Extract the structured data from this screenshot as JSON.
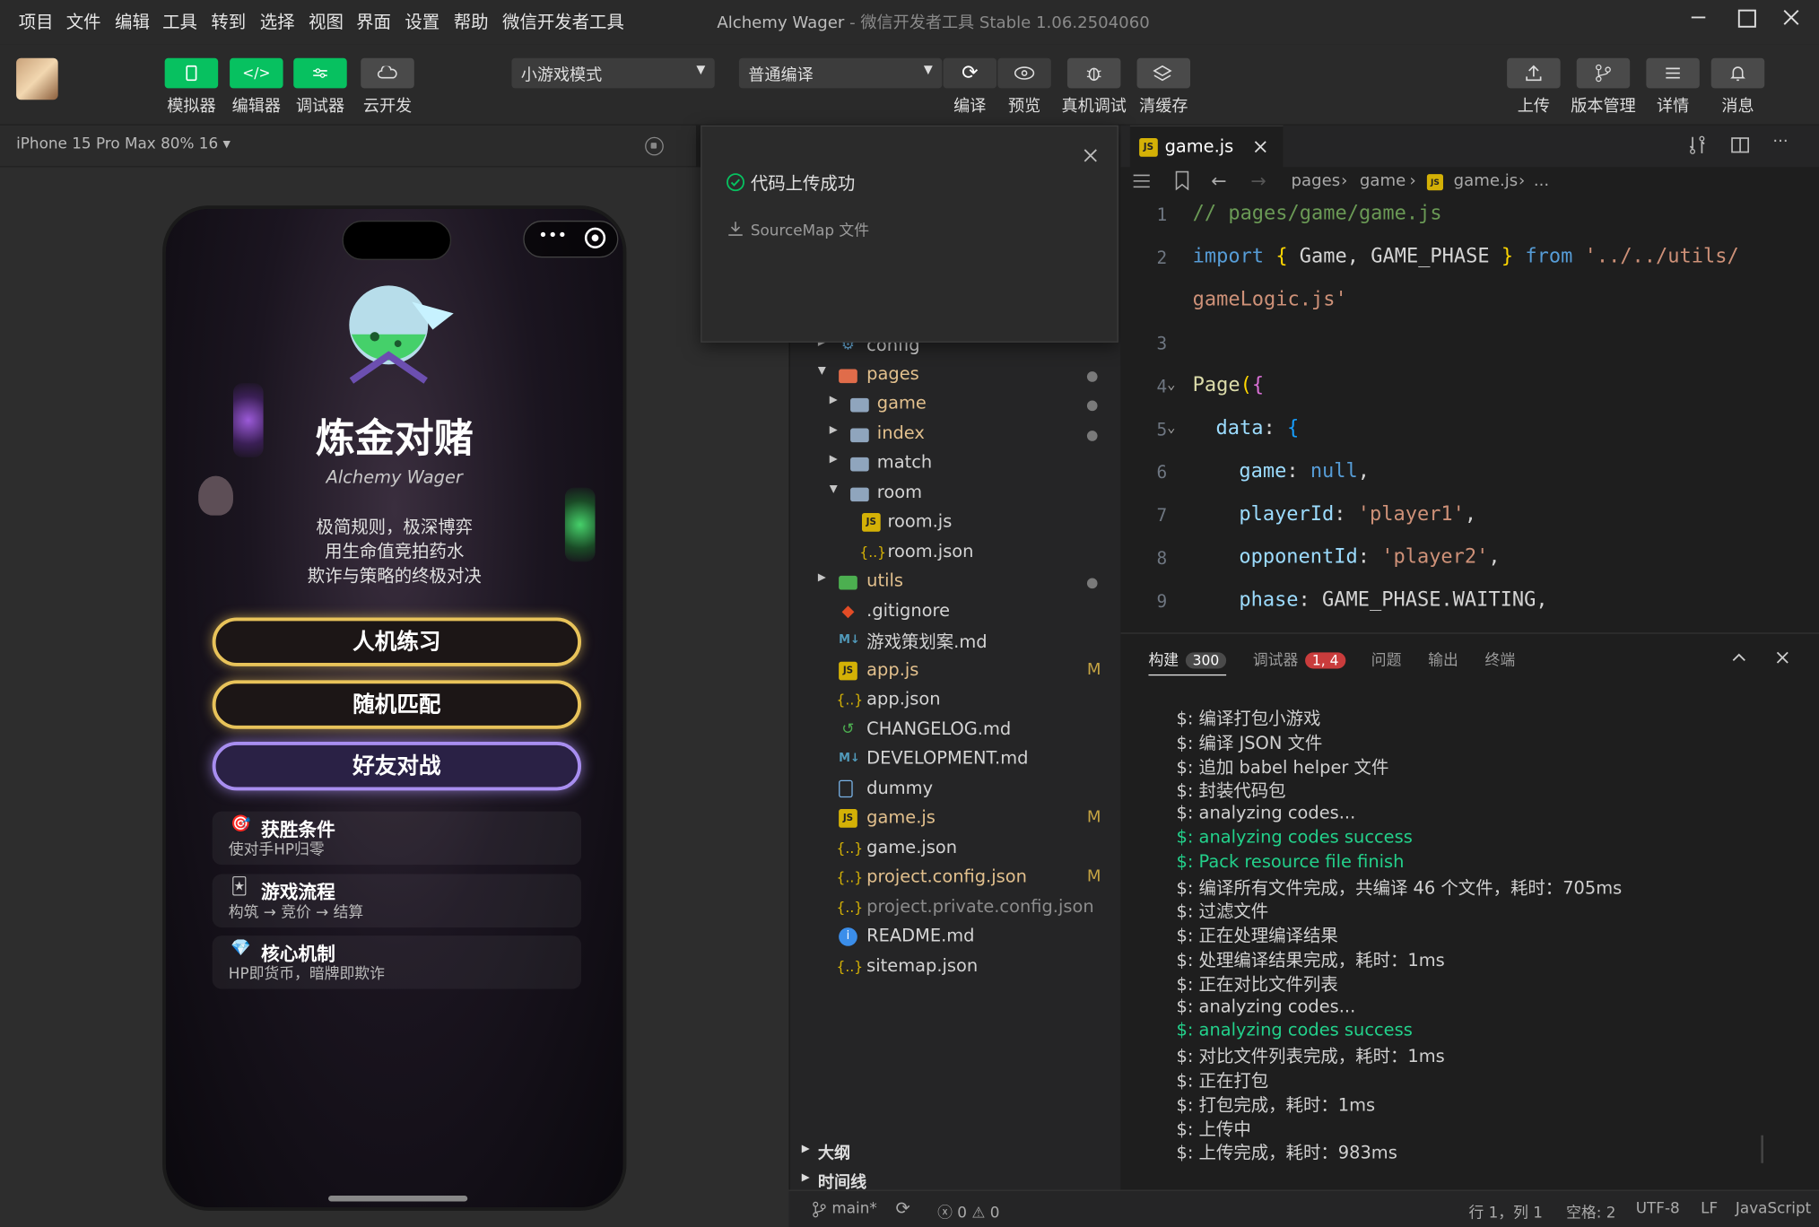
{
  "menubar": {
    "items": [
      "项目",
      "文件",
      "编辑",
      "工具",
      "转到",
      "选择",
      "视图",
      "界面",
      "设置",
      "帮助",
      "微信开发者工具"
    ],
    "app_title": "Alchemy Wager",
    "app_subtitle": "- 微信开发者工具 Stable 1.06.2504060"
  },
  "toolbar": {
    "simulator": "模拟器",
    "editor": "编辑器",
    "debugger": "调试器",
    "cloud": "云开发",
    "mode_select": "小游戏模式",
    "compile_select": "普通编译",
    "compile": "编译",
    "preview": "预览",
    "device_debug": "真机调试",
    "clear_cache": "清缓存",
    "upload": "上传",
    "version": "版本管理",
    "details": "详情",
    "messages": "消息"
  },
  "simulator": {
    "device": "iPhone 15 Pro Max 80% 16 ▾"
  },
  "game": {
    "title": "炼金对赌",
    "subtitle": "Alchemy Wager",
    "tagline1": "极简规则，极深博弈",
    "tagline2": "用生命值竞拍药水",
    "tagline3": "欺诈与策略的终极对决",
    "btn_ai": "人机练习",
    "btn_random": "随机匹配",
    "btn_friend": "好友对战",
    "cards": [
      {
        "title": "获胜条件",
        "desc": "使对手HP归零"
      },
      {
        "title": "游戏流程",
        "desc": "构筑 → 竞价 → 结算"
      },
      {
        "title": "核心机制",
        "desc": "HP即货币，暗牌即欺诈"
      }
    ]
  },
  "popup": {
    "message": "代码上传成功",
    "sourcemap": "SourceMap 文件"
  },
  "explorer": {
    "rows": [
      {
        "name": "config",
        "status": ""
      },
      {
        "name": "pages",
        "status": ""
      },
      {
        "name": "game",
        "status": ""
      },
      {
        "name": "index",
        "status": ""
      },
      {
        "name": "match",
        "status": ""
      },
      {
        "name": "room",
        "status": ""
      },
      {
        "name": "room.js",
        "status": ""
      },
      {
        "name": "room.json",
        "status": ""
      },
      {
        "name": "utils",
        "status": ""
      },
      {
        "name": ".gitignore",
        "status": ""
      },
      {
        "name": "游戏策划案.md",
        "status": ""
      },
      {
        "name": "app.js",
        "status": "M"
      },
      {
        "name": "app.json",
        "status": ""
      },
      {
        "name": "CHANGELOG.md",
        "status": ""
      },
      {
        "name": "DEVELOPMENT.md",
        "status": ""
      },
      {
        "name": "dummy",
        "status": ""
      },
      {
        "name": "game.js",
        "status": "M"
      },
      {
        "name": "game.json",
        "status": ""
      },
      {
        "name": "project.config.json",
        "status": "M"
      },
      {
        "name": "project.private.config.json",
        "status": ""
      },
      {
        "name": "README.md",
        "status": ""
      },
      {
        "name": "sitemap.json",
        "status": ""
      }
    ],
    "outline": "大纲",
    "timeline": "时间线"
  },
  "editor": {
    "tab": "game.js",
    "breadcrumb": [
      "pages",
      "game",
      "game.js",
      "..."
    ],
    "code": {
      "l1": "// pages/game/game.js",
      "l2_import": "import",
      "l2_names": " Game, GAME_PHASE ",
      "l2_from": "from",
      "l2_path": "'../../utils/",
      "l2b_path": "gameLogic.js'",
      "l4_page": "Page",
      "l5_data": "data",
      "l6_key": "game",
      "l6_val": "null",
      "l7_key": "playerId",
      "l7_val": "'player1'",
      "l8_key": "opponentId",
      "l8_val": "'player2'",
      "l9_key": "phase",
      "l9_val": "GAME_PHASE.WAITING"
    }
  },
  "panel": {
    "tab_build": "构建",
    "build_count": "300",
    "tab_debugger": "调试器",
    "debugger_count": "1, 4",
    "tab_problems": "问题",
    "tab_output": "输出",
    "tab_terminal": "终端",
    "logs": [
      {
        "text": "$: 编译打包小游戏",
        "ok": false
      },
      {
        "text": "$: 编译 JSON 文件",
        "ok": false
      },
      {
        "text": "$: 追加 babel helper 文件",
        "ok": false
      },
      {
        "text": "$: 封装代码包",
        "ok": false
      },
      {
        "text": "$: analyzing codes...",
        "ok": false
      },
      {
        "text": "$: analyzing codes success",
        "ok": true
      },
      {
        "text": "$: Pack resource file finish",
        "ok": true
      },
      {
        "text": "$: 编译所有文件完成，共编译 46 个文件，耗时：705ms",
        "ok": false
      },
      {
        "text": "$: 过滤文件",
        "ok": false
      },
      {
        "text": "$: 正在处理编译结果",
        "ok": false
      },
      {
        "text": "$: 处理编译结果完成，耗时：1ms",
        "ok": false
      },
      {
        "text": "$: 正在对比文件列表",
        "ok": false
      },
      {
        "text": "$: analyzing codes...",
        "ok": false
      },
      {
        "text": "$: analyzing codes success",
        "ok": true
      },
      {
        "text": "$: 对比文件列表完成，耗时：1ms",
        "ok": false
      },
      {
        "text": "$: 正在打包",
        "ok": false
      },
      {
        "text": "$: 打包完成，耗时：1ms",
        "ok": false
      },
      {
        "text": "$: 上传中",
        "ok": false
      },
      {
        "text": "$: 上传完成，耗时：983ms",
        "ok": false
      }
    ]
  },
  "statusbar": {
    "branch": "main*",
    "errors": "0",
    "warnings": "0",
    "position": "行 1，列 1",
    "spaces": "空格: 2",
    "encoding": "UTF-8",
    "eol": "LF",
    "language": "JavaScript"
  },
  "colors": {
    "accent": "#07c160",
    "gold_border": "#e8c35a",
    "purple_border": "#a88ef0"
  }
}
